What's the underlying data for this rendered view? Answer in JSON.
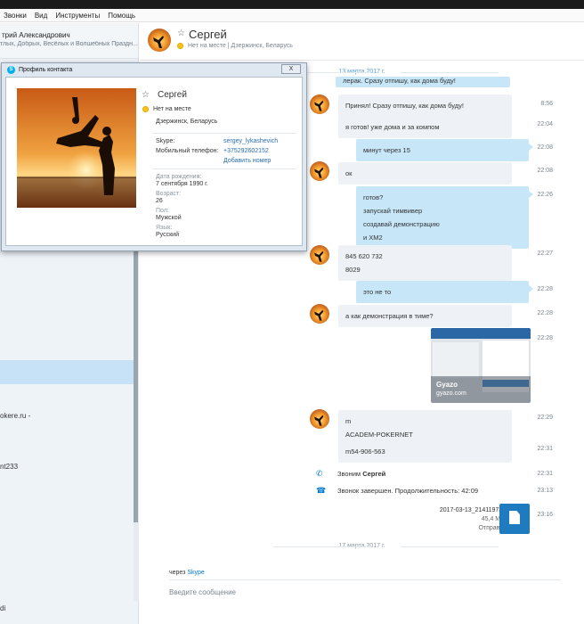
{
  "menu": [
    "Звонки",
    "Вид",
    "Инструменты",
    "Помощь"
  ],
  "me": {
    "name": "трий Александрович",
    "mood": "тлых, Добрых, Весёлых и Волшебных Праздн..."
  },
  "sidebar_items": [
    "okere.ru -",
    "nt233",
    "di"
  ],
  "conversation": {
    "name": "Сергей",
    "status": "Нет на месте",
    "location": "Дзержинск, Беларусь"
  },
  "dates": {
    "first": "13 марта 2017 г.",
    "second": "17 марта 2017 г."
  },
  "messages": [
    {
      "text": "лерак. Сразу отпишу, как дома буду!",
      "time": ""
    },
    {
      "text": "Принял! Сразу отпишу, как дома буду!",
      "time": "8:56"
    },
    {
      "text": "я готов! уже дома и за компом",
      "time": "22:04"
    },
    {
      "text": "минут через 15",
      "time": "22:08"
    },
    {
      "text": "ок",
      "time": "22:08"
    },
    {
      "lines": [
        "готов?",
        "запускай тимвивер",
        "создавай демонстрацию",
        "и ХМ2"
      ],
      "time": "22:26"
    },
    {
      "lines": [
        "845 620 732",
        "8029"
      ],
      "time": "22:27"
    },
    {
      "text": "это не то",
      "time": "22:28"
    },
    {
      "text": "а как демонстрация в тиме?",
      "time": "22:28"
    },
    {
      "text": "",
      "time": "22:28"
    },
    {
      "lines": [
        "m",
        "ACADEM-POKERNET"
      ],
      "time": "22:29"
    },
    {
      "text": "m54-906-563",
      "time": "22:31"
    }
  ],
  "screenshot": {
    "brand": "Gyazo",
    "url": "gyazo.com"
  },
  "calls": [
    {
      "prefix": "Звоним",
      "name": "Сергей",
      "time": "22:31"
    },
    {
      "text": "Звонок завершен. Продолжительность: 42:09",
      "time": "23:13"
    }
  ],
  "file": {
    "name": "2017-03-13_214119730.flv",
    "size": "45,4 Мбайт",
    "state": "Отправлено",
    "time": "23:16"
  },
  "input": {
    "via_prefix": "через",
    "via_link": "Skype",
    "placeholder": "Введите сообщение"
  },
  "profile": {
    "window_title": "Профиль контакта",
    "close": "X",
    "name": "Сергей",
    "status": "Нет на месте",
    "location": "Дзержинск, Беларусь",
    "skype_label": "Skype:",
    "skype_value": "sergey_lykashevich",
    "mobile_label": "Мобильный телефон:",
    "mobile_value": "+375292602152",
    "add_number": "Добавить номер",
    "birth_label": "Дата рождения:",
    "birth_value": "7 сентября 1990 г.",
    "age_label": "Возраст:",
    "age_value": "26",
    "gender_label": "Пол:",
    "gender_value": "Мужской",
    "lang_label": "Язык:",
    "lang_value": "Русский"
  },
  "colors": {
    "accent": "#0078d4",
    "outgoing_bubble": "#c7e6f8",
    "incoming_bubble": "#eef1f5",
    "away": "#f8c21d"
  }
}
